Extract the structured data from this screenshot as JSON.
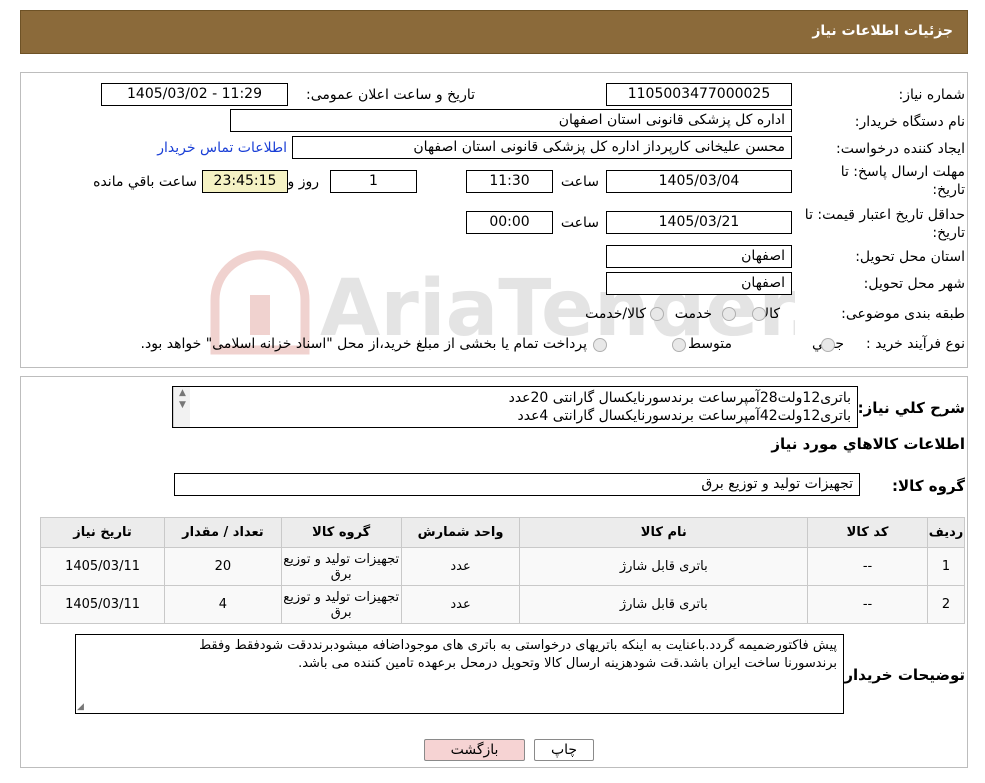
{
  "header": {
    "title": "جزئیات اطلاعات نیاز"
  },
  "form": {
    "need_number_label": "شماره نیاز:",
    "need_number": "1105003477000025",
    "announce_label": "تاریخ و ساعت اعلان عمومی:",
    "announce_value": "1405/03/02 - 11:29",
    "buyer_org_label": "نام دستگاه خریدار:",
    "buyer_org": "اداره کل پزشکی قانونی استان اصفهان",
    "creator_label": "ایجاد کننده درخواست:",
    "creator": "محسن علیخانی کارپرداز اداره کل پزشکی قانونی استان اصفهان",
    "contact_link": "اطلاعات تماس خریدار",
    "deadline_label_1": "مهلت ارسال پاسخ: تا",
    "deadline_label_2": "تاریخ:",
    "deadline_date": "1405/03/04",
    "time_label": "ساعت",
    "deadline_time": "11:30",
    "days_value": "1",
    "days_label": "روز و",
    "remaining_time": "23:45:15",
    "remaining_label": "ساعت باقي مانده",
    "validity_label_1": "حداقل تاریخ اعتبار قیمت: تا",
    "validity_label_2": "تاریخ:",
    "validity_date": "1405/03/21",
    "validity_time": "00:00",
    "province_label": "استان محل تحویل:",
    "province": "اصفهان",
    "city_label": "شهر محل تحویل:",
    "city": "اصفهان",
    "category_label": "طبقه بندی موضوعی:",
    "category_options": [
      "کالا",
      "خدمت",
      "کالا/خدمت"
    ],
    "process_label": "نوع فرآیند خرید :",
    "process_options": [
      "جزيي",
      "متوسط"
    ],
    "process_note": "پرداخت تمام یا بخشی از مبلغ خرید،از محل \"اسناد خزانه اسلامی\" خواهد بود."
  },
  "description": {
    "label": "شرح کلي نياز:",
    "lines": [
      "باتری12ولت28آمپرساعت برندسورنایکسال گارانتی 20عدد",
      "باتری12ولت42آمپرساعت برندسورنایکسال گارانتی 4عدد"
    ]
  },
  "goods_info_title": "اطلاعات کالاهاي مورد نياز",
  "goods_group": {
    "label": "گروه کالا:",
    "value": "تجهیزات تولید و توزیع برق"
  },
  "table": {
    "headers": [
      "ردیف",
      "کد کالا",
      "نام کالا",
      "واحد شمارش",
      "گروه کالا",
      "تعداد / مقدار",
      "تاریخ نیاز"
    ],
    "rows": [
      [
        "1",
        "--",
        "باتری قابل شارژ",
        "عدد",
        "تجهیزات تولید و توزیع برق",
        "20",
        "1405/03/11"
      ],
      [
        "2",
        "--",
        "باتری قابل شارژ",
        "عدد",
        "تجهیزات تولید و توزیع برق",
        "4",
        "1405/03/11"
      ]
    ]
  },
  "buyer_notes": {
    "label": "توضیحات خریدار:",
    "lines": [
      "پیش فاکتورضمیمه گردد.باعنایت به اینکه باتریهای درخواستی به باتری های موجوداضافه میشودبرنددقت شودفقط وفقط",
      "برندسورنا ساخت ایران باشد.قت شودهزینه ارسال کالا وتحویل درمحل برعهده تامین کننده می باشد."
    ]
  },
  "buttons": {
    "print": "چاپ",
    "back": "بازگشت"
  },
  "watermark": {
    "text": "AriaTender.neT"
  },
  "colors": {
    "header_bg": "#8b6a3a",
    "timer_bg": "#f5f2c4",
    "back_btn_bg": "#f6d3d3",
    "link": "#1a3fd6"
  }
}
